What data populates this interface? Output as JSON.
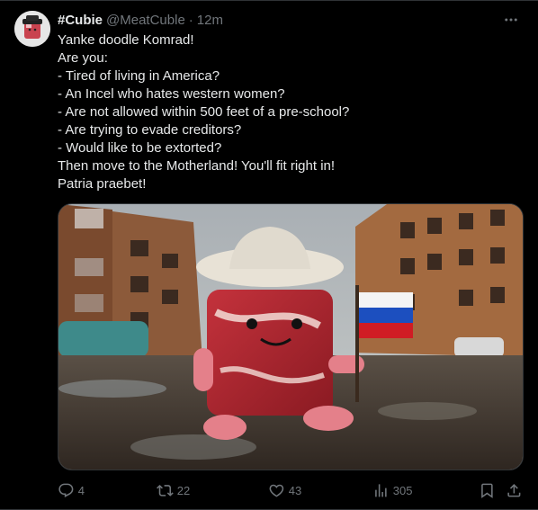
{
  "tweet": {
    "display_name": "#Cubie",
    "handle": "@MeatCuble",
    "separator": "·",
    "time": "12m",
    "lines": [
      "Yanke doodle Komrad!",
      "Are you:",
      "- Tired of living in America?",
      "- An Incel who hates western women?",
      "- Are not allowed within 500 feet of a pre-school?",
      "- Are trying to evade creditors?",
      "- Would like to be extorted?",
      "Then move to the Motherland! You'll fit right in!",
      "Patria praebet!"
    ]
  },
  "actions": {
    "replies": "4",
    "retweets": "22",
    "likes": "43",
    "views": "305"
  },
  "icons": {
    "more": "more-horizontal-icon",
    "reply": "reply-icon",
    "retweet": "retweet-icon",
    "like": "heart-icon",
    "views": "views-bar-chart-icon",
    "bookmark": "bookmark-icon",
    "share": "share-icon"
  },
  "colors": {
    "background": "#000000",
    "text": "#e7e9ea",
    "muted": "#71767b",
    "border": "#2f3336"
  }
}
